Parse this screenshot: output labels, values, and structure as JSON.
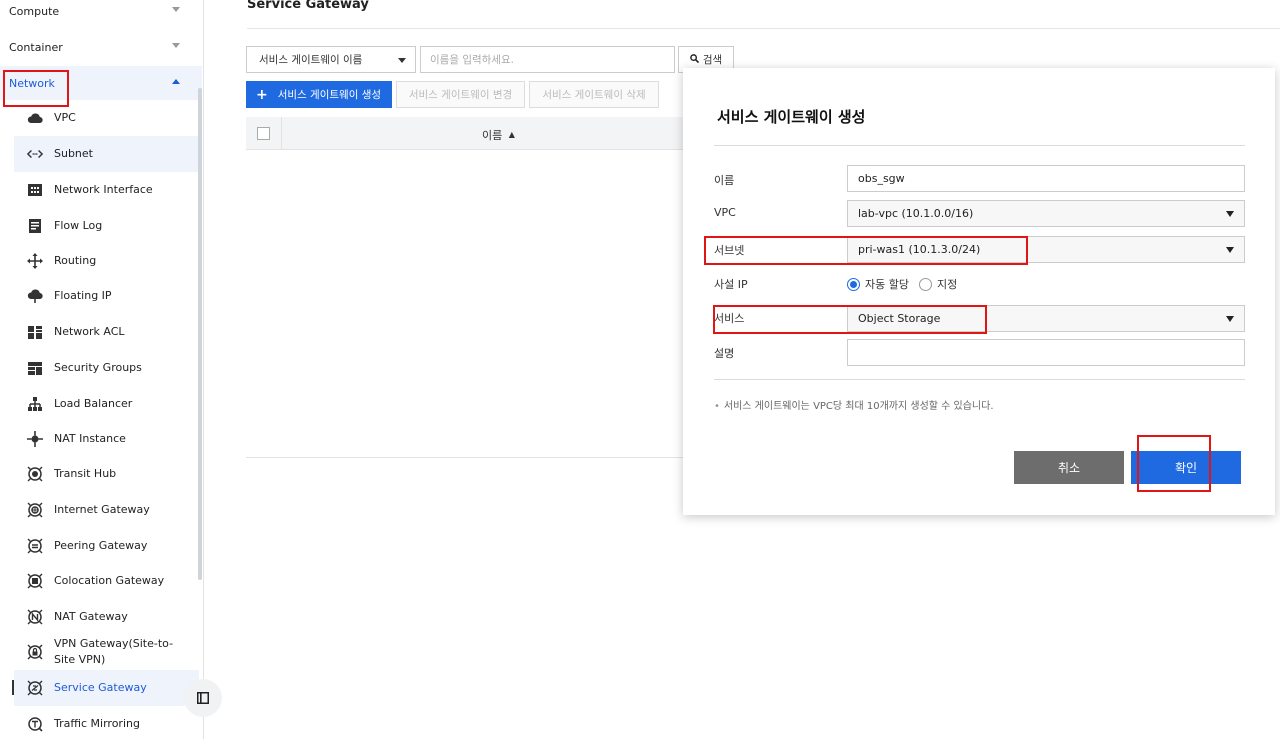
{
  "sidebar": {
    "categories": [
      {
        "label": "Compute"
      },
      {
        "label": "Container"
      },
      {
        "label": "Network"
      }
    ],
    "items": [
      {
        "label": "VPC",
        "icon": "cloud-icon"
      },
      {
        "label": "Subnet",
        "icon": "code-arrows-icon"
      },
      {
        "label": "Network Interface",
        "icon": "network-card-icon"
      },
      {
        "label": "Flow Log",
        "icon": "log-file-icon"
      },
      {
        "label": "Routing",
        "icon": "routing-arrows-icon"
      },
      {
        "label": "Floating IP",
        "icon": "cloud-upload-icon"
      },
      {
        "label": "Network ACL",
        "icon": "acl-grid-icon"
      },
      {
        "label": "Security Groups",
        "icon": "security-groups-icon"
      },
      {
        "label": "Load Balancer",
        "icon": "hierarchy-icon"
      },
      {
        "label": "NAT Instance",
        "icon": "hub-node-icon"
      },
      {
        "label": "Transit Hub",
        "icon": "transit-hub-icon"
      },
      {
        "label": "Internet Gateway",
        "icon": "internet-gateway-icon"
      },
      {
        "label": "Peering Gateway",
        "icon": "peering-gateway-icon"
      },
      {
        "label": "Colocation Gateway",
        "icon": "colocation-gateway-icon"
      },
      {
        "label": "NAT Gateway",
        "icon": "nat-gateway-icon"
      },
      {
        "label": "VPN Gateway(Site-to-",
        "label2": "Site VPN)",
        "icon": "vpn-gateway-icon"
      },
      {
        "label": "Service Gateway",
        "icon": "service-gateway-icon"
      },
      {
        "label": "Traffic Mirroring",
        "icon": "traffic-mirroring-icon"
      }
    ]
  },
  "main": {
    "title": "Service Gateway",
    "filter_select": "서비스 게이트웨이 이름",
    "search_placeholder": "이름을 입력하세요.",
    "search_button": "검색",
    "create_button": "서비스 게이트웨이 생성",
    "edit_button": "서비스 게이트웨이 변경",
    "delete_button": "서비스 게이트웨이 삭제",
    "column_name": "이름"
  },
  "modal": {
    "title": "서비스 게이트웨이 생성",
    "fields": {
      "name_label": "이름",
      "name_value": "obs_sgw",
      "vpc_label": "VPC",
      "vpc_value": "lab-vpc (10.1.0.0/16)",
      "subnet_label": "서브넷",
      "subnet_value": "pri-was1 (10.1.3.0/24)",
      "private_ip_label": "사설 IP",
      "ip_auto": "자동 할당",
      "ip_manual": "지정",
      "service_label": "서비스",
      "service_value": "Object Storage",
      "desc_label": "설명",
      "desc_value": ""
    },
    "note": "서비스 게이트웨이는 VPC당 최대 10개까지 생성할 수 있습니다.",
    "cancel": "취소",
    "confirm": "확인"
  },
  "colors": {
    "accent": "#1f6ae0",
    "annotation": "#e01515",
    "cancel": "#6d6d6d"
  }
}
